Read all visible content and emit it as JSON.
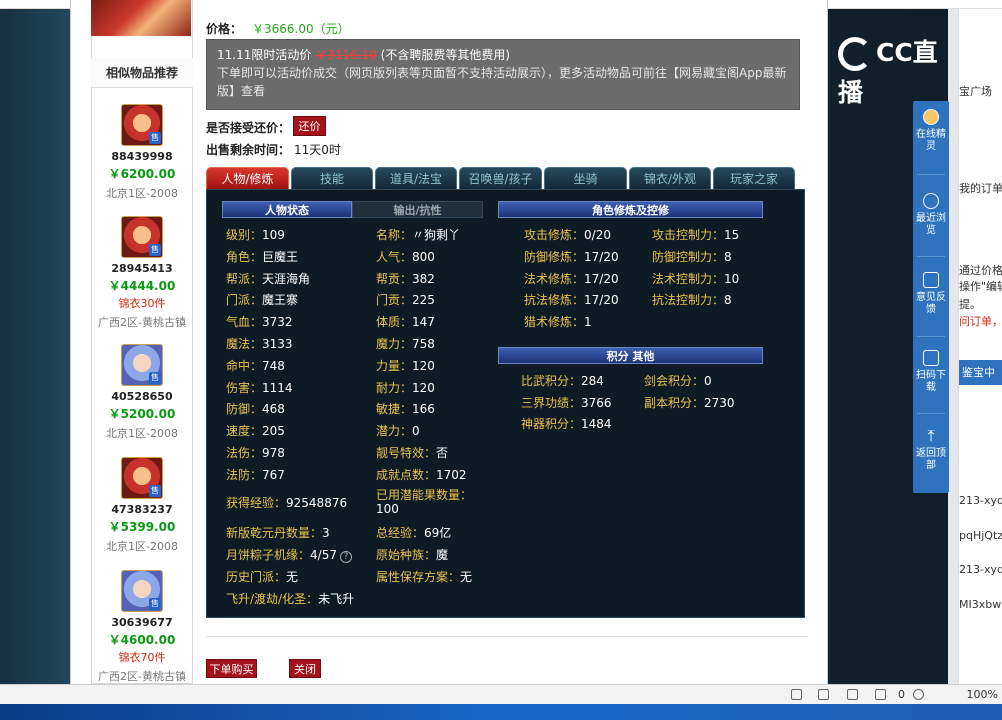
{
  "item": {
    "price_label": "价格：",
    "price_value": "￥3666.00（元）",
    "promo": {
      "line1_prefix": "11.11限时活动价",
      "line1_price": "￥3116.10",
      "line1_suffix": "(不含聘服费等其他费用)",
      "line2": "下单即可以活动价成交（网页版列表等页面暂不支持活动展示），更多活动物品可前往【网易藏宝阁App最新版】查看"
    },
    "bargain_label": "是否接受还价：",
    "bargain_button": "还价",
    "time_label": "出售剩余时间：",
    "time_value": "11天0时"
  },
  "sidebar": {
    "title": "相似物品推荐",
    "items": [
      {
        "id": "88439998",
        "price": "￥6200.00",
        "extra": "",
        "server": "北京1区-2008",
        "avatar": "red"
      },
      {
        "id": "28945413",
        "price": "￥4444.00",
        "extra": "锦衣30件",
        "server": "广西2区-黄桃古镇",
        "avatar": "red"
      },
      {
        "id": "40528650",
        "price": "￥5200.00",
        "extra": "",
        "server": "北京1区-2008",
        "avatar": "blue"
      },
      {
        "id": "47383237",
        "price": "￥5399.00",
        "extra": "",
        "server": "北京1区-2008",
        "avatar": "red"
      },
      {
        "id": "30639677",
        "price": "￥4600.00",
        "extra": "锦衣70件",
        "server": "广西2区-黄桃古镇",
        "avatar": "blue"
      }
    ],
    "sale_tag": "售"
  },
  "tabs": [
    "人物/修炼",
    "技能",
    "道具/法宝",
    "召唤兽/孩子",
    "坐骑",
    "锦衣/外观",
    "玩家之家"
  ],
  "panel": {
    "hdr_status": "人物状态",
    "hdr_output": "输出/抗性",
    "hdr_cultivation": "角色修炼及控修",
    "hdr_score": "积分 其他",
    "col1": [
      {
        "k": "级别：",
        "v": "109"
      },
      {
        "k": "角色：",
        "v": "巨魔王"
      },
      {
        "k": "帮派：",
        "v": "天涯海角"
      },
      {
        "k": "门派：",
        "v": "魔王寨"
      },
      {
        "k": "气血：",
        "v": "3732"
      },
      {
        "k": "魔法：",
        "v": "3133"
      },
      {
        "k": "命中：",
        "v": "748"
      },
      {
        "k": "伤害：",
        "v": "1114"
      },
      {
        "k": "防御：",
        "v": "468"
      },
      {
        "k": "速度：",
        "v": "205"
      },
      {
        "k": "法伤：",
        "v": "978"
      },
      {
        "k": "法防：",
        "v": "767"
      }
    ],
    "col2": [
      {
        "k": "名称：",
        "v": "〃狗剩丫"
      },
      {
        "k": "人气：",
        "v": "800"
      },
      {
        "k": "帮贡：",
        "v": "382"
      },
      {
        "k": "门贡：",
        "v": "225"
      },
      {
        "k": "体质：",
        "v": "147"
      },
      {
        "k": "魔力：",
        "v": "758"
      },
      {
        "k": "力量：",
        "v": "120"
      },
      {
        "k": "耐力：",
        "v": "120"
      },
      {
        "k": "敏捷：",
        "v": "166"
      },
      {
        "k": "潜力：",
        "v": "0"
      },
      {
        "k": "靓号特效：",
        "v": "否"
      },
      {
        "k": "成就点数：",
        "v": "1702"
      }
    ],
    "exp": {
      "k": "获得经验：",
      "v": "92548876"
    },
    "used_energy": {
      "k": "已用潜能果数量：",
      "v": "100"
    },
    "qianyuan": {
      "k": "新版乾元丹数量：",
      "v": "3"
    },
    "total_exp": {
      "k": "总经验：",
      "v": "69亿"
    },
    "mooncake": {
      "k": "月饼粽子机缘：",
      "v": "4/57"
    },
    "origin_race": {
      "k": "原始种族：",
      "v": "魔"
    },
    "history_school": {
      "k": "历史门派：",
      "v": "无"
    },
    "attr_save": {
      "k": "属性保存方案：",
      "v": "无"
    },
    "ascension": {
      "k": "飞升/渡劫/化圣：",
      "v": "未飞升"
    },
    "cultivation": [
      {
        "k": "攻击修炼：",
        "v": "0/20",
        "k2": "攻击控制力：",
        "v2": "15"
      },
      {
        "k": "防御修炼：",
        "v": "17/20",
        "k2": "防御控制力：",
        "v2": "8"
      },
      {
        "k": "法术修炼：",
        "v": "17/20",
        "k2": "法术控制力：",
        "v2": "10"
      },
      {
        "k": "抗法修炼：",
        "v": "17/20",
        "k2": "抗法控制力：",
        "v2": "8"
      },
      {
        "k": "猎术修炼：",
        "v": "1"
      }
    ],
    "score": [
      {
        "k": "比武积分：",
        "v": "284",
        "k2": "剑会积分：",
        "v2": "0"
      },
      {
        "k": "三界功绩：",
        "v": "3766",
        "k2": "副本积分：",
        "v2": "2730"
      },
      {
        "k": "神器积分：",
        "v": "1484"
      }
    ],
    "help_glyph": "?"
  },
  "actions": {
    "buy": "下单购买",
    "close": "关闭"
  },
  "overlay": {
    "logo_text": "CC直播",
    "float": [
      "在线精灵",
      "最近浏览",
      "意见反馈",
      "扫码下载",
      "返回顶部"
    ]
  },
  "right_panel": {
    "lines": [
      "宝广场",
      "我的订单",
      "通过价格",
      "操作\"编辑",
      "提。",
      "问订单，",
      "鉴宝中",
      "213-xyq-",
      "pqHjQtz",
      "213-xyq-",
      "MI3xbwl"
    ]
  },
  "statusbar": {
    "zoom": "100%",
    "counter": "0"
  }
}
